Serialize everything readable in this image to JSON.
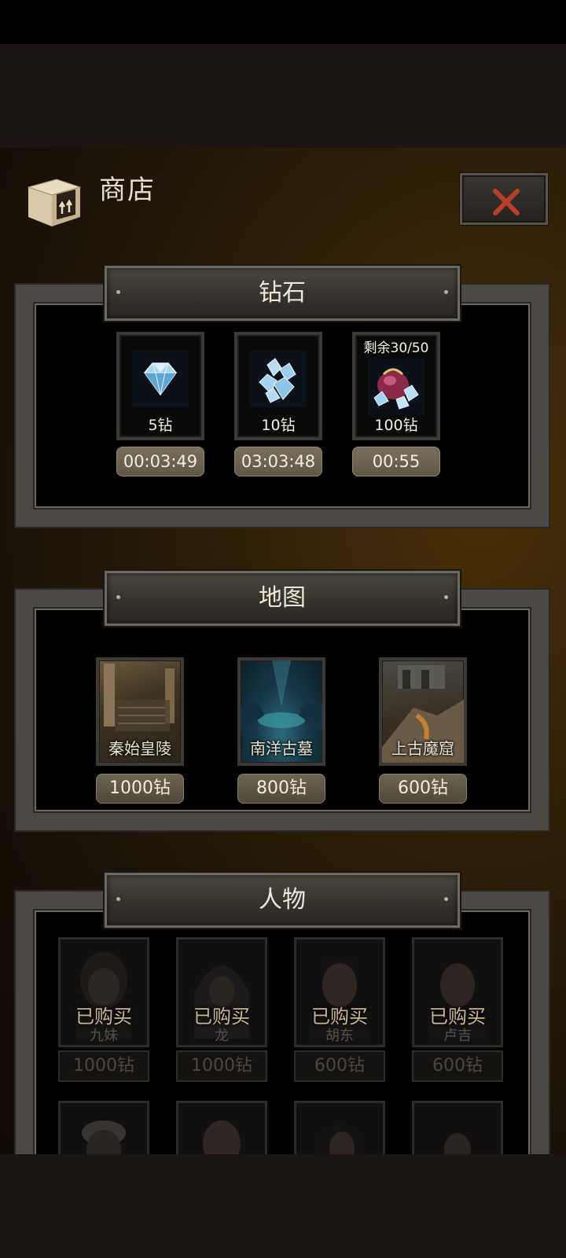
{
  "header": {
    "title": "商店",
    "close_icon": "close-x-icon"
  },
  "sections": {
    "diamond": {
      "title": "钻石",
      "items": [
        {
          "label": "5钻",
          "timer": "00:03:49",
          "icon": "single-diamond-icon"
        },
        {
          "label": "10钻",
          "timer": "03:03:48",
          "icon": "diamond-pile-icon"
        },
        {
          "label": "100钻",
          "timer": "00:55",
          "remaining": "剩余30/50",
          "icon": "diamond-bag-icon"
        }
      ]
    },
    "map": {
      "title": "地图",
      "items": [
        {
          "name": "秦始皇陵",
          "price": "1000钻"
        },
        {
          "name": "南洋古墓",
          "price": "800钻"
        },
        {
          "name": "上古魔窟",
          "price": "600钻"
        }
      ]
    },
    "character": {
      "title": "人物",
      "items": [
        {
          "status": "已购买",
          "name": "九妹",
          "price": "1000钻"
        },
        {
          "status": "已购买",
          "name": "龙",
          "price": "1000钻"
        },
        {
          "status": "已购买",
          "name": "胡东",
          "price": "600钻"
        },
        {
          "status": "已购买",
          "name": "卢吉",
          "price": "600钻"
        }
      ]
    }
  },
  "colors": {
    "accent_gold": "#c9b98a",
    "close_red": "#b8402a",
    "frame": "#4c4944"
  }
}
